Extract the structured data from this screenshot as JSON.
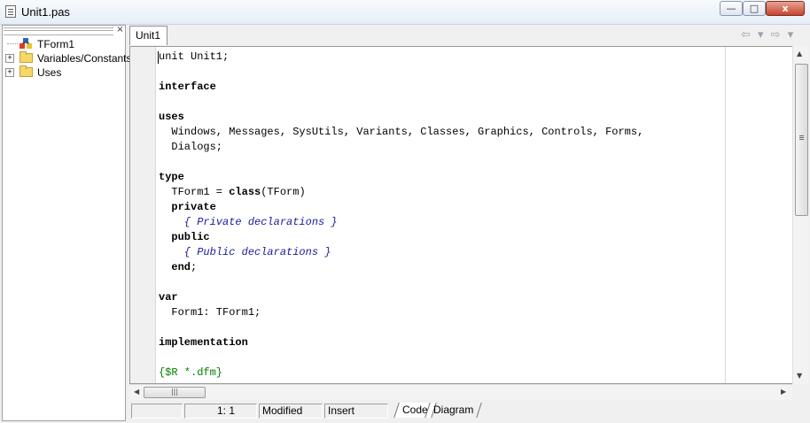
{
  "window": {
    "title": "Unit1.pas",
    "controls": {
      "minimize": "—",
      "maximize": "□",
      "close": "x"
    }
  },
  "tree": {
    "close_glyph": "×",
    "items": [
      {
        "label": "TForm1",
        "icon": "form-icon",
        "expandable": false
      },
      {
        "label": "Variables/Constants",
        "icon": "folder-icon",
        "expandable": true
      },
      {
        "label": "Uses",
        "icon": "folder-icon",
        "expandable": true
      }
    ]
  },
  "editor": {
    "active_tab": "Unit1",
    "nav_arrows": "⇦ ▾ ⇨ ▾",
    "lines": [
      [
        {
          "t": "unit Unit1;",
          "s": ""
        }
      ],
      [],
      [
        {
          "t": "interface",
          "s": "kw"
        }
      ],
      [],
      [
        {
          "t": "uses",
          "s": "kw"
        }
      ],
      [
        {
          "t": "  Windows, Messages, SysUtils, Variants, Classes, Graphics, Controls, Forms,",
          "s": ""
        }
      ],
      [
        {
          "t": "  Dialogs;",
          "s": ""
        }
      ],
      [],
      [
        {
          "t": "type",
          "s": "kw"
        }
      ],
      [
        {
          "t": "  TForm1 = ",
          "s": ""
        },
        {
          "t": "class",
          "s": "kw"
        },
        {
          "t": "(TForm)",
          "s": ""
        }
      ],
      [
        {
          "t": "  private",
          "s": "kw"
        }
      ],
      [
        {
          "t": "    { Private declarations }",
          "s": "cmt"
        }
      ],
      [
        {
          "t": "  public",
          "s": "kw"
        }
      ],
      [
        {
          "t": "    { Public declarations }",
          "s": "cmt"
        }
      ],
      [
        {
          "t": "  end",
          "s": "kw"
        },
        {
          "t": ";",
          "s": ""
        }
      ],
      [],
      [
        {
          "t": "var",
          "s": "kw"
        }
      ],
      [
        {
          "t": "  Form1: TForm1;",
          "s": ""
        }
      ],
      [],
      [
        {
          "t": "implementation",
          "s": "kw"
        }
      ],
      [],
      [
        {
          "t": "{$R *.dfm}",
          "s": "dir"
        }
      ]
    ]
  },
  "status": {
    "position": "1:  1",
    "modified": "Modified",
    "mode": "Insert",
    "tabs": [
      "Code",
      "Diagram"
    ],
    "active_tab": "Code"
  }
}
